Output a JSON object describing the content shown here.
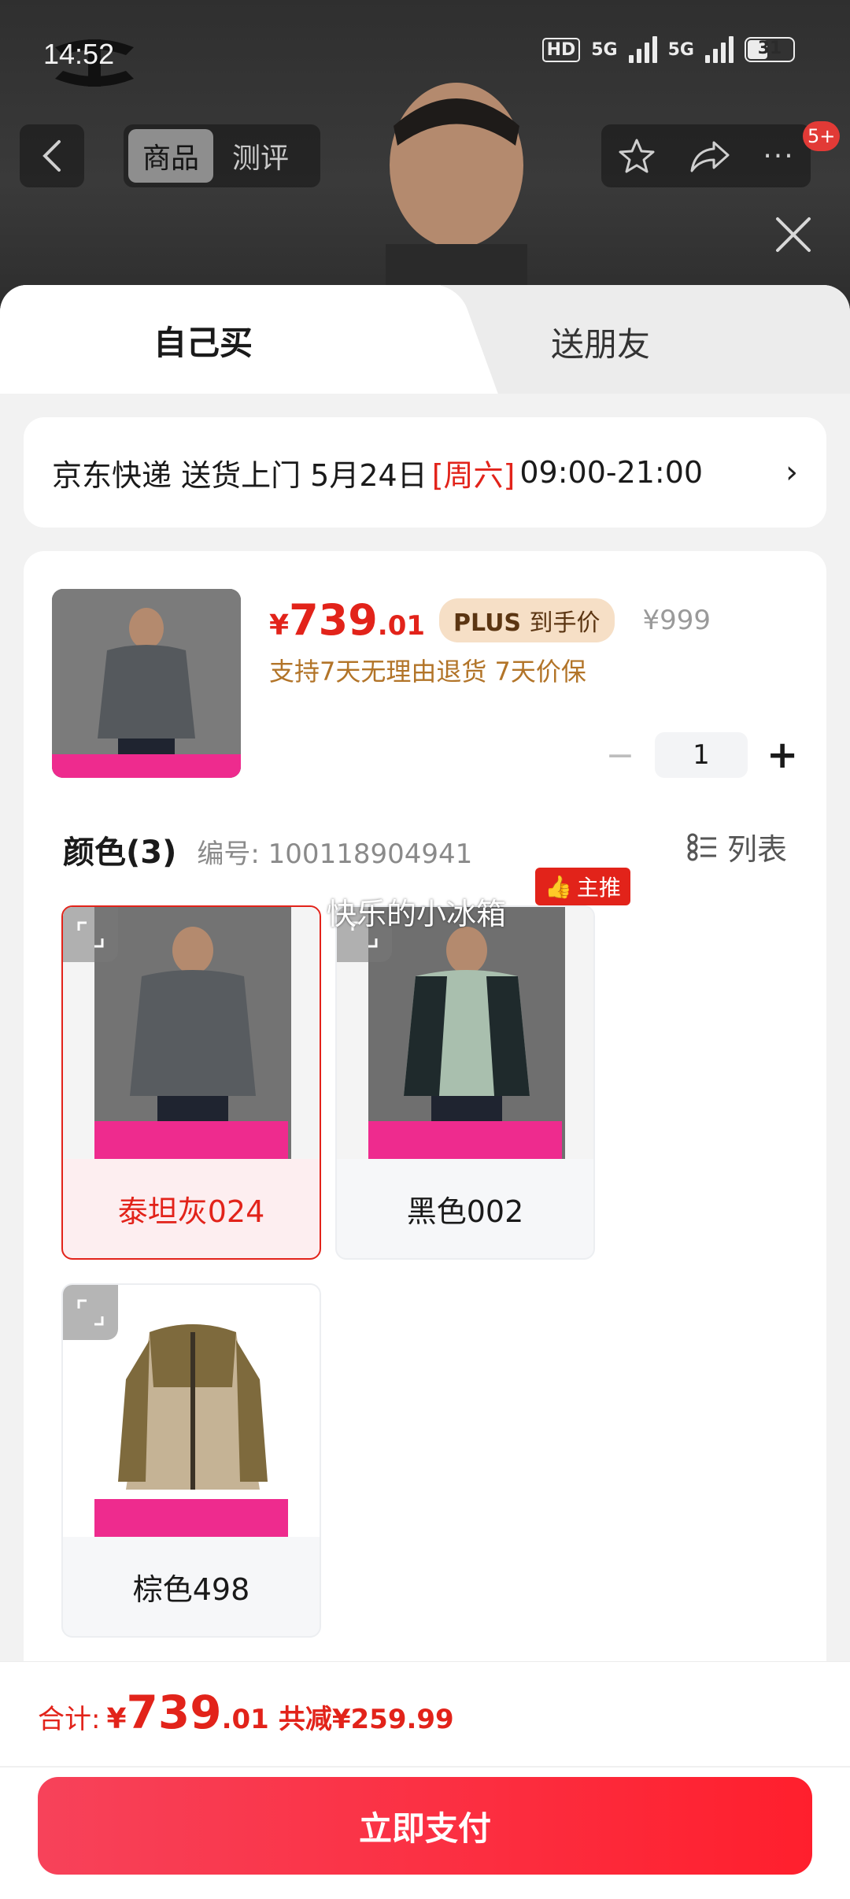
{
  "status_bar": {
    "time": "14:52",
    "hd_label": "HD",
    "network_1": "5G",
    "network_2": "5G",
    "battery": "31"
  },
  "top_nav": {
    "tabs": [
      "商品",
      "测评"
    ],
    "badge": "5+"
  },
  "purchase_tabs": {
    "self": "自己买",
    "friend": "送朋友"
  },
  "delivery": {
    "prefix": "京东快递 送货上门 5月24日",
    "weekday": "[周六]",
    "time_window": "09:00-21:00"
  },
  "product": {
    "price_symbol": "¥",
    "price_int": "739",
    "price_dec": ".01",
    "plus_tag": "PLUS",
    "plus_tag_suffix": "到手价",
    "original_price": "¥999",
    "service": "支持7天无理由退货  7天价保",
    "quantity": "1"
  },
  "color_section": {
    "title": "颜色(3)",
    "code": "编号: 100118904941",
    "list_label": "列表",
    "watermark": "快乐的小冰箱",
    "main_tag": "主推",
    "options": [
      {
        "label": "泰坦灰024",
        "selected": true
      },
      {
        "label": "黑色002",
        "selected": false
      },
      {
        "label": "棕色498",
        "selected": false
      }
    ]
  },
  "footer": {
    "total_label": "合计:",
    "total_symbol": "¥",
    "total_int": "739",
    "total_dec": ".01",
    "discount": "共减¥259.99",
    "pay_label": "立即支付"
  },
  "colors": {
    "accent_red": "#e2231a",
    "plus_gold": "#b27428",
    "promo_pink": "#ee2b8e"
  }
}
